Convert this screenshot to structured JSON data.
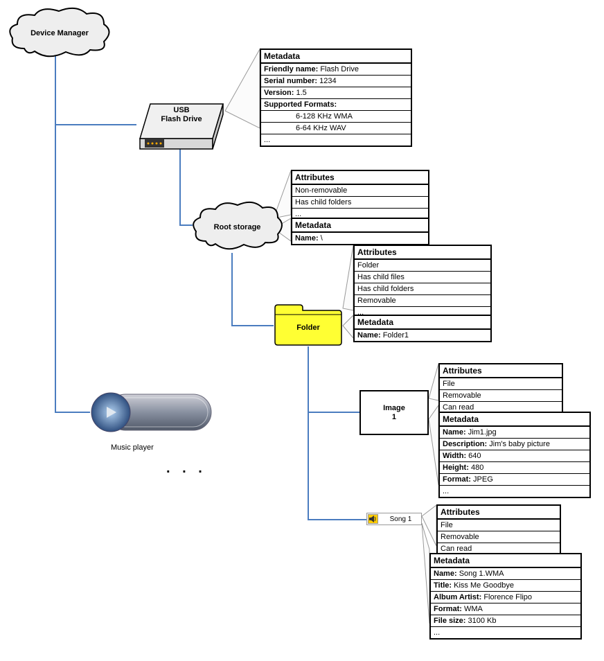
{
  "nodes": {
    "deviceManager": "Device Manager",
    "usb": {
      "line1": "USB",
      "line2": "Flash Drive"
    },
    "rootStorage": "Root storage",
    "folder": "Folder",
    "image": {
      "line1": "Image",
      "line2": "1"
    },
    "song": "Song 1",
    "musicPlayer": "Music player",
    "dots": ". . ."
  },
  "usbMetadata": {
    "title": "Metadata",
    "rows": [
      {
        "label": "Friendly name:",
        "value": "Flash Drive"
      },
      {
        "label": "Serial number:",
        "value": "1234"
      },
      {
        "label": "Version:",
        "value": "1.5"
      },
      {
        "label": "Supported Formats:",
        "value": ""
      }
    ],
    "formats": [
      "6-128 KHz WMA",
      "6-64 KHz WAV"
    ],
    "ellipsis": "..."
  },
  "rootAttributes": {
    "title": "Attributes",
    "rows": [
      "Non-removable",
      "Has child folders",
      "..."
    ]
  },
  "rootMetadata": {
    "title": "Metadata",
    "rows": [
      {
        "label": "Name:",
        "value": "\\"
      }
    ]
  },
  "folderAttributes": {
    "title": "Attributes",
    "rows": [
      "Folder",
      "Has child files",
      "Has child folders",
      "Removable",
      "..."
    ]
  },
  "folderMetadata": {
    "title": "Metadata",
    "rows": [
      {
        "label": "Name:",
        "value": "Folder1"
      }
    ]
  },
  "imageAttributes": {
    "title": "Attributes",
    "rows": [
      "File",
      "Removable",
      "Can read"
    ]
  },
  "imageMetadata": {
    "title": "Metadata",
    "rows": [
      {
        "label": "Name:",
        "value": "Jim1.jpg"
      },
      {
        "label": "Description:",
        "value": "Jim's baby picture"
      },
      {
        "label": "Width:",
        "value": "640"
      },
      {
        "label": "Height:",
        "value": "480"
      },
      {
        "label": "Format:",
        "value": "JPEG"
      }
    ],
    "ellipsis": "..."
  },
  "songAttributes": {
    "title": "Attributes",
    "rows": [
      "File",
      "Removable",
      "Can read"
    ]
  },
  "songMetadata": {
    "title": "Metadata",
    "rows": [
      {
        "label": "Name:",
        "value": "Song 1.WMA"
      },
      {
        "label": "Title:",
        "value": "Kiss Me Goodbye"
      },
      {
        "label": "Album Artist:",
        "value": "Florence Flipo"
      },
      {
        "label": "Format:",
        "value": "WMA"
      },
      {
        "label": "File size:",
        "value": "3100 Kb"
      }
    ],
    "ellipsis": "..."
  }
}
